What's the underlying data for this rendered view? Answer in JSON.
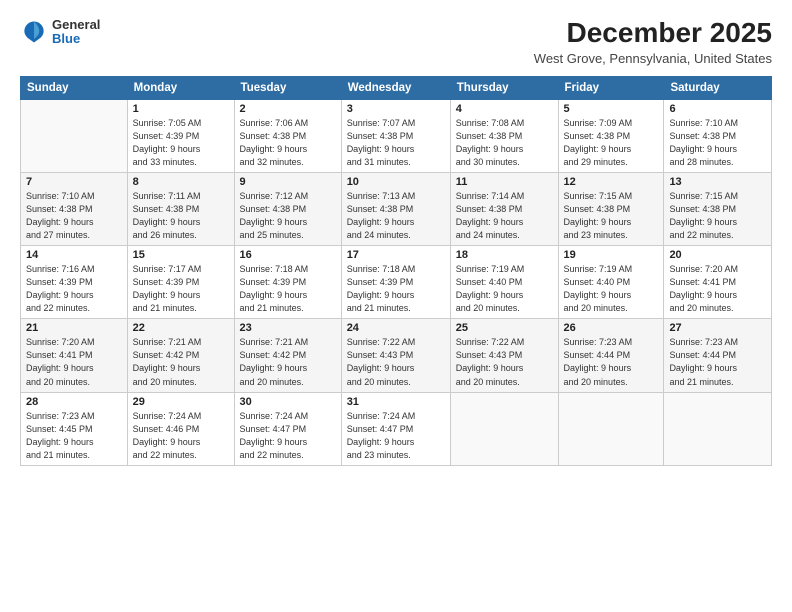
{
  "logo": {
    "general": "General",
    "blue": "Blue"
  },
  "title": "December 2025",
  "location": "West Grove, Pennsylvania, United States",
  "days_of_week": [
    "Sunday",
    "Monday",
    "Tuesday",
    "Wednesday",
    "Thursday",
    "Friday",
    "Saturday"
  ],
  "weeks": [
    [
      {
        "day": "",
        "info": ""
      },
      {
        "day": "1",
        "info": "Sunrise: 7:05 AM\nSunset: 4:39 PM\nDaylight: 9 hours\nand 33 minutes."
      },
      {
        "day": "2",
        "info": "Sunrise: 7:06 AM\nSunset: 4:38 PM\nDaylight: 9 hours\nand 32 minutes."
      },
      {
        "day": "3",
        "info": "Sunrise: 7:07 AM\nSunset: 4:38 PM\nDaylight: 9 hours\nand 31 minutes."
      },
      {
        "day": "4",
        "info": "Sunrise: 7:08 AM\nSunset: 4:38 PM\nDaylight: 9 hours\nand 30 minutes."
      },
      {
        "day": "5",
        "info": "Sunrise: 7:09 AM\nSunset: 4:38 PM\nDaylight: 9 hours\nand 29 minutes."
      },
      {
        "day": "6",
        "info": "Sunrise: 7:10 AM\nSunset: 4:38 PM\nDaylight: 9 hours\nand 28 minutes."
      }
    ],
    [
      {
        "day": "7",
        "info": ""
      },
      {
        "day": "8",
        "info": "Sunrise: 7:11 AM\nSunset: 4:38 PM\nDaylight: 9 hours\nand 26 minutes."
      },
      {
        "day": "9",
        "info": "Sunrise: 7:12 AM\nSunset: 4:38 PM\nDaylight: 9 hours\nand 25 minutes."
      },
      {
        "day": "10",
        "info": "Sunrise: 7:13 AM\nSunset: 4:38 PM\nDaylight: 9 hours\nand 24 minutes."
      },
      {
        "day": "11",
        "info": "Sunrise: 7:14 AM\nSunset: 4:38 PM\nDaylight: 9 hours\nand 24 minutes."
      },
      {
        "day": "12",
        "info": "Sunrise: 7:15 AM\nSunset: 4:38 PM\nDaylight: 9 hours\nand 23 minutes."
      },
      {
        "day": "13",
        "info": "Sunrise: 7:15 AM\nSunset: 4:38 PM\nDaylight: 9 hours\nand 22 minutes."
      }
    ],
    [
      {
        "day": "14",
        "info": ""
      },
      {
        "day": "15",
        "info": "Sunrise: 7:17 AM\nSunset: 4:39 PM\nDaylight: 9 hours\nand 21 minutes."
      },
      {
        "day": "16",
        "info": "Sunrise: 7:18 AM\nSunset: 4:39 PM\nDaylight: 9 hours\nand 21 minutes."
      },
      {
        "day": "17",
        "info": "Sunrise: 7:18 AM\nSunset: 4:39 PM\nDaylight: 9 hours\nand 21 minutes."
      },
      {
        "day": "18",
        "info": "Sunrise: 7:19 AM\nSunset: 4:40 PM\nDaylight: 9 hours\nand 20 minutes."
      },
      {
        "day": "19",
        "info": "Sunrise: 7:19 AM\nSunset: 4:40 PM\nDaylight: 9 hours\nand 20 minutes."
      },
      {
        "day": "20",
        "info": "Sunrise: 7:20 AM\nSunset: 4:41 PM\nDaylight: 9 hours\nand 20 minutes."
      }
    ],
    [
      {
        "day": "21",
        "info": ""
      },
      {
        "day": "22",
        "info": "Sunrise: 7:21 AM\nSunset: 4:42 PM\nDaylight: 9 hours\nand 20 minutes."
      },
      {
        "day": "23",
        "info": "Sunrise: 7:21 AM\nSunset: 4:42 PM\nDaylight: 9 hours\nand 20 minutes."
      },
      {
        "day": "24",
        "info": "Sunrise: 7:22 AM\nSunset: 4:43 PM\nDaylight: 9 hours\nand 20 minutes."
      },
      {
        "day": "25",
        "info": "Sunrise: 7:22 AM\nSunset: 4:43 PM\nDaylight: 9 hours\nand 20 minutes."
      },
      {
        "day": "26",
        "info": "Sunrise: 7:23 AM\nSunset: 4:44 PM\nDaylight: 9 hours\nand 20 minutes."
      },
      {
        "day": "27",
        "info": "Sunrise: 7:23 AM\nSunset: 4:44 PM\nDaylight: 9 hours\nand 21 minutes."
      }
    ],
    [
      {
        "day": "28",
        "info": "Sunrise: 7:23 AM\nSunset: 4:45 PM\nDaylight: 9 hours\nand 21 minutes."
      },
      {
        "day": "29",
        "info": "Sunrise: 7:24 AM\nSunset: 4:46 PM\nDaylight: 9 hours\nand 22 minutes."
      },
      {
        "day": "30",
        "info": "Sunrise: 7:24 AM\nSunset: 4:47 PM\nDaylight: 9 hours\nand 22 minutes."
      },
      {
        "day": "31",
        "info": "Sunrise: 7:24 AM\nSunset: 4:47 PM\nDaylight: 9 hours\nand 23 minutes."
      },
      {
        "day": "",
        "info": ""
      },
      {
        "day": "",
        "info": ""
      },
      {
        "day": "",
        "info": ""
      }
    ]
  ],
  "week7_sunday_info": "Sunrise: 7:10 AM\nSunset: 4:38 PM\nDaylight: 9 hours\nand 27 minutes.",
  "week14_sunday_info": "Sunrise: 7:16 AM\nSunset: 4:39 PM\nDaylight: 9 hours\nand 22 minutes.",
  "week21_sunday_info": "Sunrise: 7:20 AM\nSunset: 4:41 PM\nDaylight: 9 hours\nand 20 minutes."
}
